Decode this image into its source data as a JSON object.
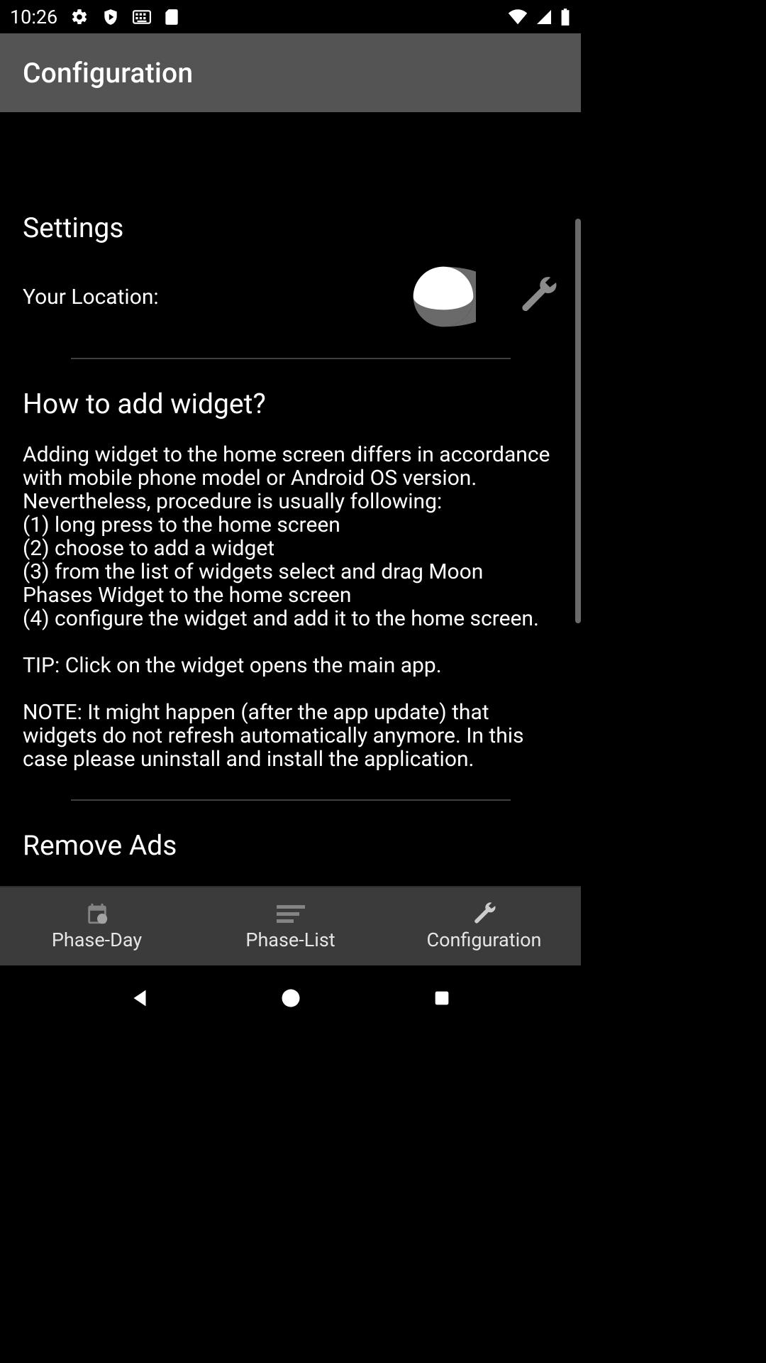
{
  "status": {
    "time": "10:26",
    "icons_left": [
      "gear-icon",
      "shield-play-icon",
      "keyboard-icon",
      "sd-card-icon"
    ],
    "icons_right": [
      "wifi-icon",
      "signal-icon",
      "battery-icon"
    ]
  },
  "app_bar": {
    "title": "Configuration"
  },
  "settings": {
    "heading": "Settings",
    "location_label": "Your Location:",
    "location_value": "",
    "moon_icon": "moon-phase-icon",
    "tool_icon": "wrench-icon"
  },
  "howto": {
    "heading": "How to add widget?",
    "body": "Adding widget to the home screen differs in accordance with mobile phone model or Android OS version. Nevertheless, procedure is usually following:\n(1) long press to the home screen\n(2) choose to add a widget\n(3) from the list of widgets select and drag Moon Phases Widget to the home screen\n(4) configure the widget and add it to the home screen.\n\nTIP: Click on the widget opens the main app.\n\nNOTE: It might happen (after the app update) that widgets do not refresh automatically anymore. In this case please uninstall and install the application."
  },
  "remove_ads": {
    "heading": "Remove Ads"
  },
  "tabs": [
    {
      "label": "Phase-Day",
      "icon": "calendar-icon",
      "active": false
    },
    {
      "label": "Phase-List",
      "icon": "list-icon",
      "active": false
    },
    {
      "label": "Configuration",
      "icon": "wrench-icon",
      "active": true
    }
  ],
  "nav": {
    "back": "back-icon",
    "home": "home-icon",
    "recent": "recent-icon"
  }
}
